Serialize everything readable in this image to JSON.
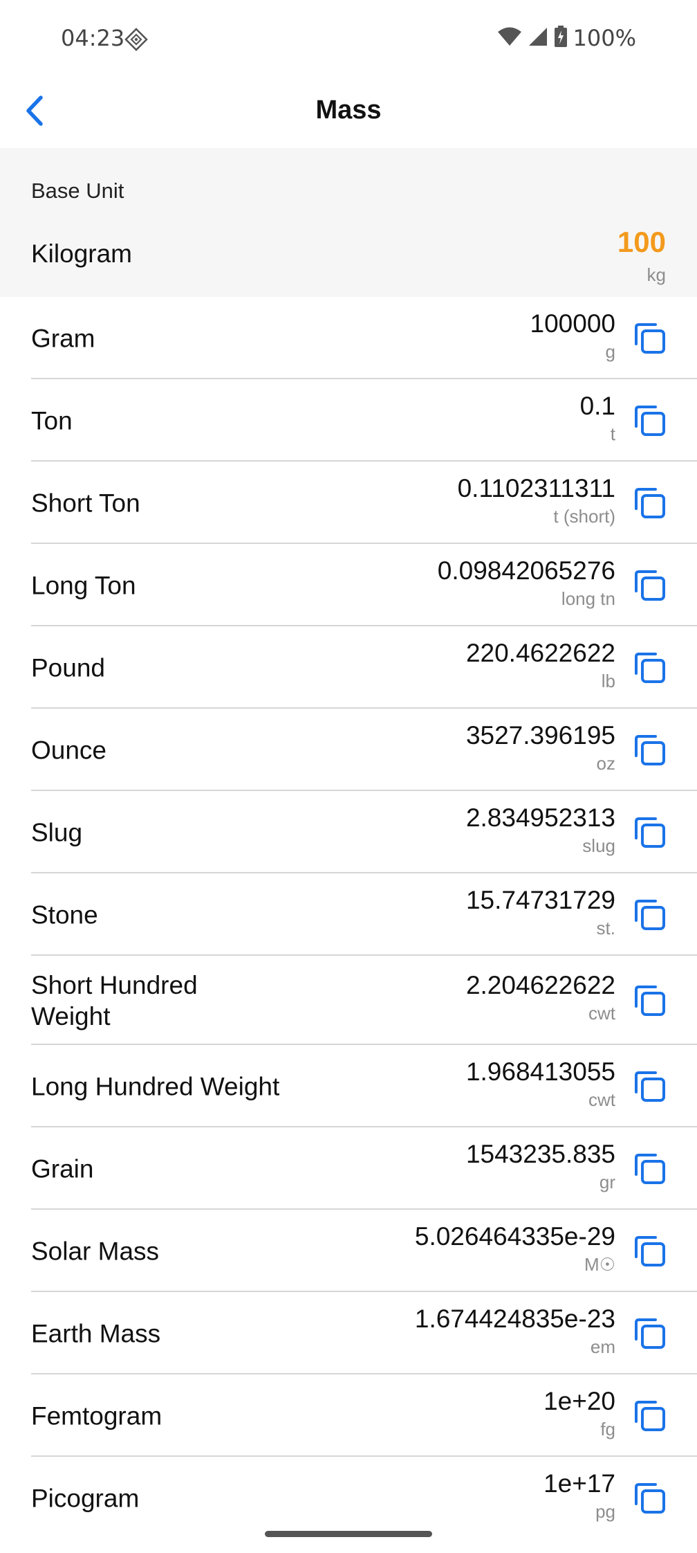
{
  "status_bar": {
    "time": "04:23",
    "battery": "100%",
    "icons": [
      "navigation-icon",
      "wifi-icon",
      "signal-icon",
      "battery-charging-icon"
    ]
  },
  "header": {
    "title": "Mass",
    "back_icon": "chevron-left-icon"
  },
  "base": {
    "label": "Base Unit",
    "unit": "Kilogram",
    "value": "100",
    "symbol": "kg"
  },
  "colors": {
    "accent": "#1a73e8",
    "value_highlight": "#f39a1d",
    "base_background": "#f6f6f6"
  },
  "units": [
    {
      "name": "Gram",
      "value": "100000",
      "symbol": "g"
    },
    {
      "name": "Ton",
      "value": "0.1",
      "symbol": "t"
    },
    {
      "name": "Short Ton",
      "value": "0.1102311311",
      "symbol": "t (short)"
    },
    {
      "name": "Long Ton",
      "value": "0.09842065276",
      "symbol": "long tn"
    },
    {
      "name": "Pound",
      "value": "220.4622622",
      "symbol": "lb"
    },
    {
      "name": "Ounce",
      "value": "3527.396195",
      "symbol": "oz"
    },
    {
      "name": "Slug",
      "value": "2.834952313",
      "symbol": "slug"
    },
    {
      "name": "Stone",
      "value": "15.74731729",
      "symbol": "st."
    },
    {
      "name": "Short Hundred Weight",
      "value": "2.204622622",
      "symbol": "cwt"
    },
    {
      "name": "Long Hundred Weight",
      "value": "1.968413055",
      "symbol": "cwt"
    },
    {
      "name": "Grain",
      "value": "1543235.835",
      "symbol": "gr"
    },
    {
      "name": "Solar Mass",
      "value": "5.026464335e-29",
      "symbol": "M☉"
    },
    {
      "name": "Earth Mass",
      "value": "1.674424835e-23",
      "symbol": "em"
    },
    {
      "name": "Femtogram",
      "value": "1e+20",
      "symbol": "fg"
    },
    {
      "name": "Picogram",
      "value": "1e+17",
      "symbol": "pg"
    }
  ]
}
